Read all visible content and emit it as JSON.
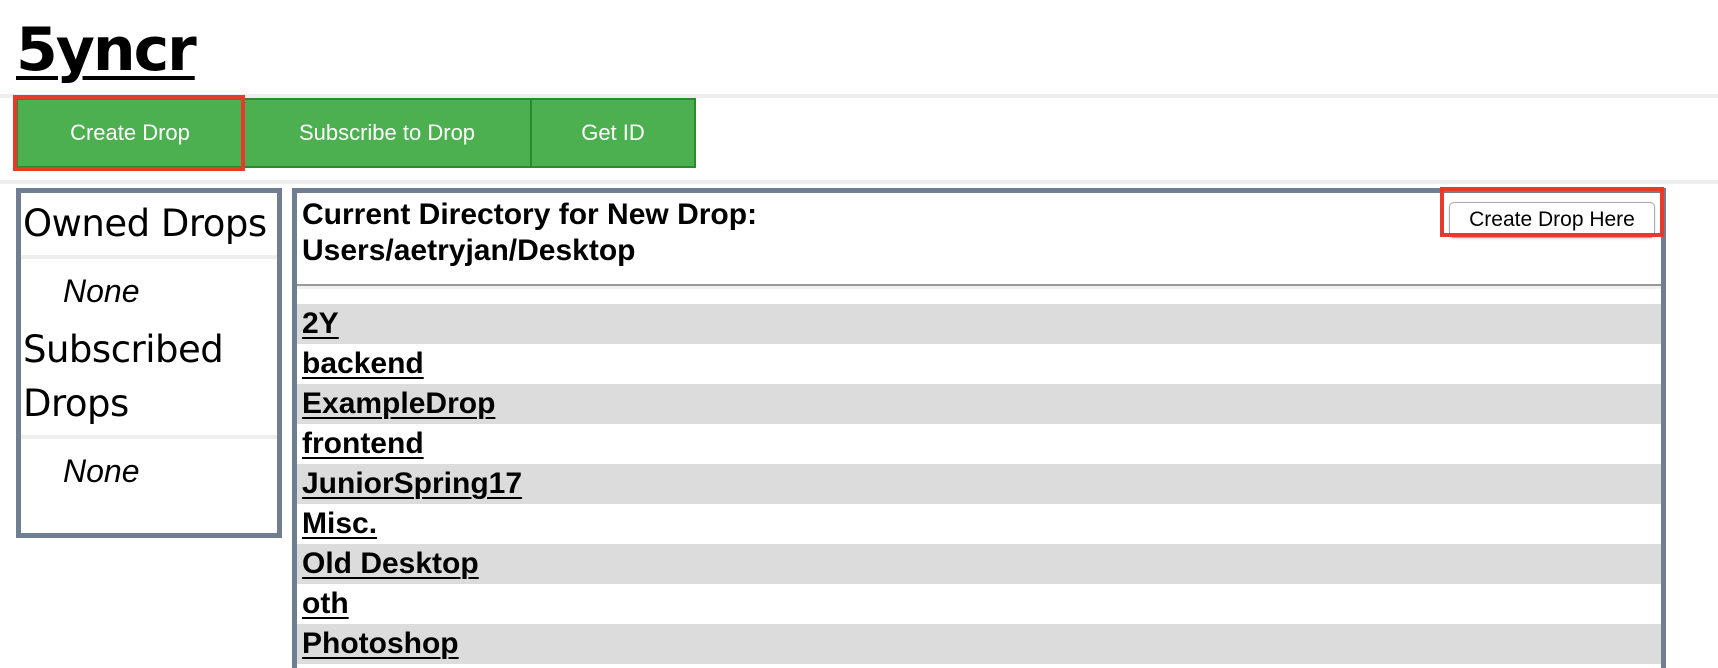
{
  "app": {
    "title": "5yncr"
  },
  "nav": {
    "create_label": "Create Drop",
    "subscribe_label": "Subscribe to Drop",
    "getid_label": "Get ID"
  },
  "sidebar": {
    "owned_heading": "Owned Drops",
    "owned_empty": "None",
    "subscribed_heading": "Subscribed Drops",
    "subscribed_empty": "None"
  },
  "main": {
    "directory_label": "Current Directory for New Drop:",
    "directory_path": "Users/aetryjan/Desktop",
    "create_here_label": "Create Drop Here",
    "entries": [
      "2Y",
      "backend",
      "ExampleDrop",
      "frontend",
      "JuniorSpring17",
      "Misc.",
      "Old Desktop",
      "oth",
      "Photoshop"
    ]
  },
  "colors": {
    "nav_green": "#4caf50",
    "panel_border": "#6f7f91",
    "highlight_red": "#e8392b",
    "row_stripe": "#dcdcdc"
  }
}
